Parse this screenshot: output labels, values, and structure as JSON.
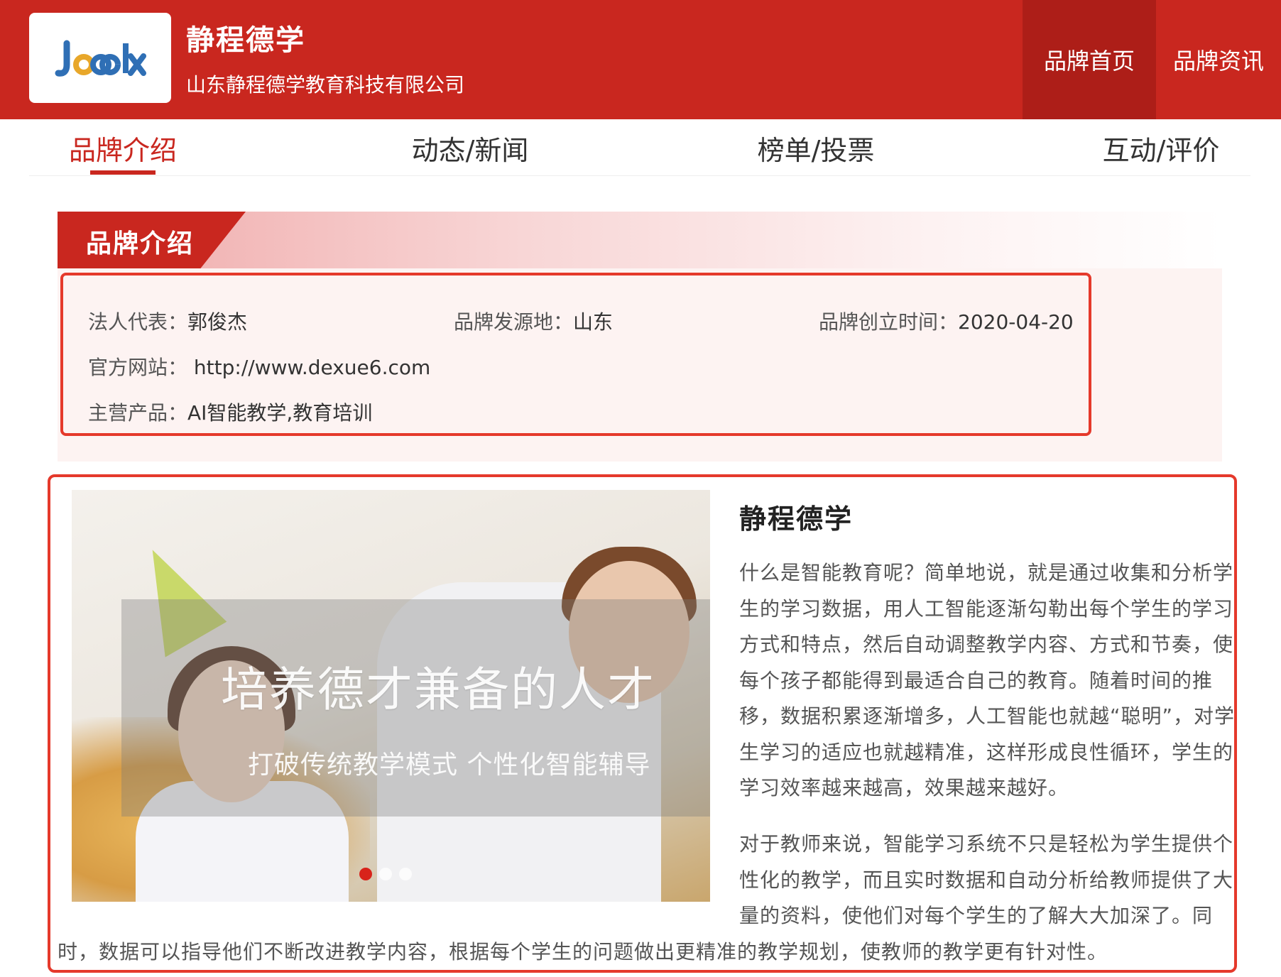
{
  "header": {
    "logo_text": "Jcdx",
    "brand_name": "静程德学",
    "company_name": "山东静程德学教育科技有限公司",
    "nav": [
      "品牌首页",
      "品牌资讯"
    ]
  },
  "tabs": [
    "品牌介绍",
    "动态/新闻",
    "榜单/投票",
    "互动/评价"
  ],
  "section_title": "品牌介绍",
  "info": {
    "legal_rep_label": "法人代表：",
    "legal_rep": "郭俊杰",
    "origin_label": "品牌发源地：",
    "origin": "山东",
    "founded_label": "品牌创立时间：",
    "founded": "2020-04-20",
    "website_label": "官方网站：",
    "website": "http://www.dexue6.com",
    "products_label": "主营产品：",
    "products": "AI智能教学,教育培训"
  },
  "banner": {
    "headline": "培养德才兼备的人才",
    "subline": "打破传统教学模式 个性化智能辅导"
  },
  "article": {
    "title": "静程德学",
    "p1_lines": [
      "什么是智能教育呢？简单地说，就是通过收集和分析学",
      "生的学习数据，用人工智能逐渐勾勒出每个学生的学习",
      "方式和特点，然后自动调整教学内容、方式和节奏，使",
      "每个孩子都能得到最适合自己的教育。随着时间的推",
      "移，数据积累逐渐增多，人工智能也就越“聪明”，对学",
      "生学习的适应也就越精准，这样形成良性循环，学生的",
      "学习效率越来越高，效果越来越好。"
    ],
    "p2_lines": [
      "对于教师来说，智能学习系统不只是轻松为学生提供个",
      "性化的教学，而且实时数据和自动分析给教师提供了大",
      "量的资料，使他们对每个学生的了解大大加深了。同"
    ],
    "p2_tail": "时，数据可以指导他们不断改进教学内容，根据每个学生的问题做出更精准的教学规划，使教师的教学更有针对性。"
  },
  "colors": {
    "brand_red": "#c9271f",
    "nav_active": "#ad1e18",
    "border_red": "#e5392b",
    "info_bg": "#fdf3f2"
  }
}
